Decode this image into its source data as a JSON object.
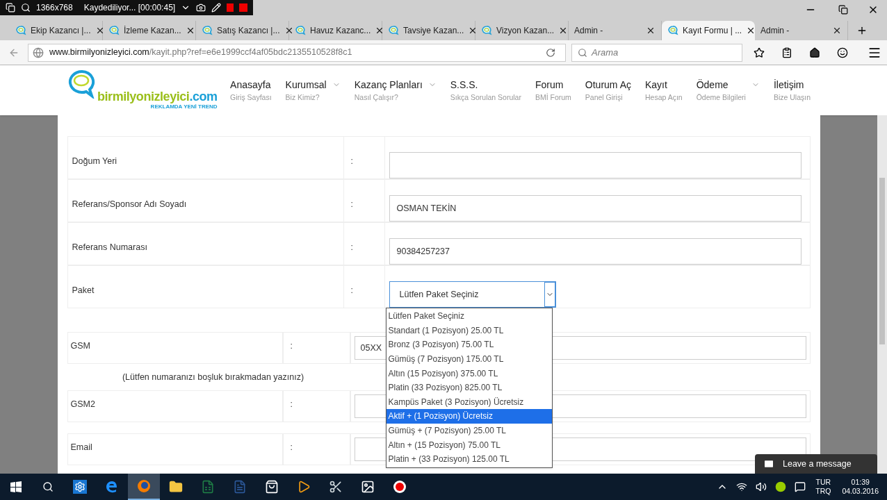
{
  "recorder": {
    "resolution": "1366x768",
    "status": "Kaydediliyor... [00:00:45]"
  },
  "browser": {
    "tabs": [
      {
        "title": "Ekip Kazancı |...",
        "favicon": true,
        "selected": false
      },
      {
        "title": "İzleme Kazan...",
        "favicon": true,
        "selected": false
      },
      {
        "title": "Satış Kazancı |...",
        "favicon": true,
        "selected": false
      },
      {
        "title": "Havuz Kazanc...",
        "favicon": true,
        "selected": false
      },
      {
        "title": "Tavsiye Kazan...",
        "favicon": true,
        "selected": false
      },
      {
        "title": "Vizyon Kazan...",
        "favicon": true,
        "selected": false
      },
      {
        "title": "Admin -",
        "favicon": false,
        "selected": false
      },
      {
        "title": "Kayıt Formu | ...",
        "favicon": true,
        "selected": true
      },
      {
        "title": "Admin -",
        "favicon": false,
        "selected": false
      }
    ],
    "url_domain": "www.birmilyonizleyici.com",
    "url_path": "/kayit.php?ref=e6e1999ccf4af05bdc2135510528f8c1",
    "search_placeholder": "Arama"
  },
  "site": {
    "logo": {
      "name": "birmilyonizleyici",
      "tld": ".com",
      "tagline": "REKLAMDA YENİ TREND"
    },
    "nav": [
      {
        "label": "Anasayfa",
        "sub": "Giriş Sayfası",
        "has_menu": false
      },
      {
        "label": "Kurumsal",
        "sub": "Biz Kimiz?",
        "has_menu": true
      },
      {
        "label": "Kazanç Planları",
        "sub": "Nasıl Çalışır?",
        "has_menu": true
      },
      {
        "label": "S.S.S.",
        "sub": "Sıkça Sorulan Sorular",
        "has_menu": false
      },
      {
        "label": "Forum",
        "sub": "BMİ Forum",
        "has_menu": false
      },
      {
        "label": "Oturum Aç",
        "sub": "Panel Girişi",
        "has_menu": false
      },
      {
        "label": "Kayıt",
        "sub": "Hesap Açın",
        "has_menu": false
      },
      {
        "label": "Ödeme",
        "sub": "Ödeme Bilgileri",
        "has_menu": true
      },
      {
        "label": "İletişim",
        "sub": "Bize Ulaşın",
        "has_menu": false
      }
    ]
  },
  "form": {
    "rows": [
      {
        "label": "Doğum Yeri",
        "colon": ":",
        "kind": "text",
        "value": ""
      },
      {
        "label": "Referans/Sponsor Adı Soyadı",
        "colon": ":",
        "kind": "text",
        "value": "OSMAN TEKİN"
      },
      {
        "label": "Referans Numarası",
        "colon": ":",
        "kind": "text",
        "value": "90384257237"
      },
      {
        "label": "Paket",
        "colon": ":",
        "kind": "select",
        "value": "Lütfen Paket Seçiniz",
        "expanded": true
      }
    ],
    "package_options": [
      {
        "label": "Lütfen Paket Seçiniz",
        "selected": false
      },
      {
        "label": "Standart (1 Pozisyon) 25.00 TL",
        "selected": false
      },
      {
        "label": "Bronz (3 Pozisyon) 75.00 TL",
        "selected": false
      },
      {
        "label": "Gümüş (7 Pozisyon) 175.00 TL",
        "selected": false
      },
      {
        "label": "Altın (15 Pozisyon) 375.00 TL",
        "selected": false
      },
      {
        "label": "Platin (33 Pozisyon) 825.00 TL",
        "selected": false
      },
      {
        "label": "Kampüs Paket (3 Pozisyon) Ücretsiz",
        "selected": false
      },
      {
        "label": "Aktif + (1 Pozisyon) Ücretsiz",
        "selected": true
      },
      {
        "label": "Gümüş + (7 Pozisyon) 25.00 TL",
        "selected": false
      },
      {
        "label": "Altın + (15 Pozisyon) 75.00 TL",
        "selected": false
      },
      {
        "label": "Platin + (33 Pozisyon) 125.00 TL",
        "selected": false
      }
    ],
    "contact_rows": [
      {
        "label": "GSM",
        "colon": ":",
        "value": "05XX"
      },
      {
        "label": "GSM2",
        "colon": ":",
        "value": ""
      },
      {
        "label": "Email",
        "colon": ":",
        "value": ""
      }
    ],
    "gsm_hint": "(Lütfen numaranızı boşluk bırakmadan yazınız)"
  },
  "chat": {
    "label": "Leave a message"
  },
  "taskbar": {
    "apps": [
      {
        "kind": "settings",
        "active": false
      },
      {
        "kind": "edge",
        "active": false
      },
      {
        "kind": "firefox",
        "active": true
      },
      {
        "kind": "folder",
        "active": false
      },
      {
        "kind": "excel",
        "active": false
      },
      {
        "kind": "word",
        "active": false
      },
      {
        "kind": "store",
        "active": false
      },
      {
        "kind": "media",
        "active": false
      },
      {
        "kind": "paint",
        "active": false
      },
      {
        "kind": "photos",
        "active": false
      },
      {
        "kind": "record",
        "active": false
      }
    ],
    "language": "TUR",
    "layout": "TRQ",
    "time": "01:39",
    "date": "04.03.2016"
  }
}
